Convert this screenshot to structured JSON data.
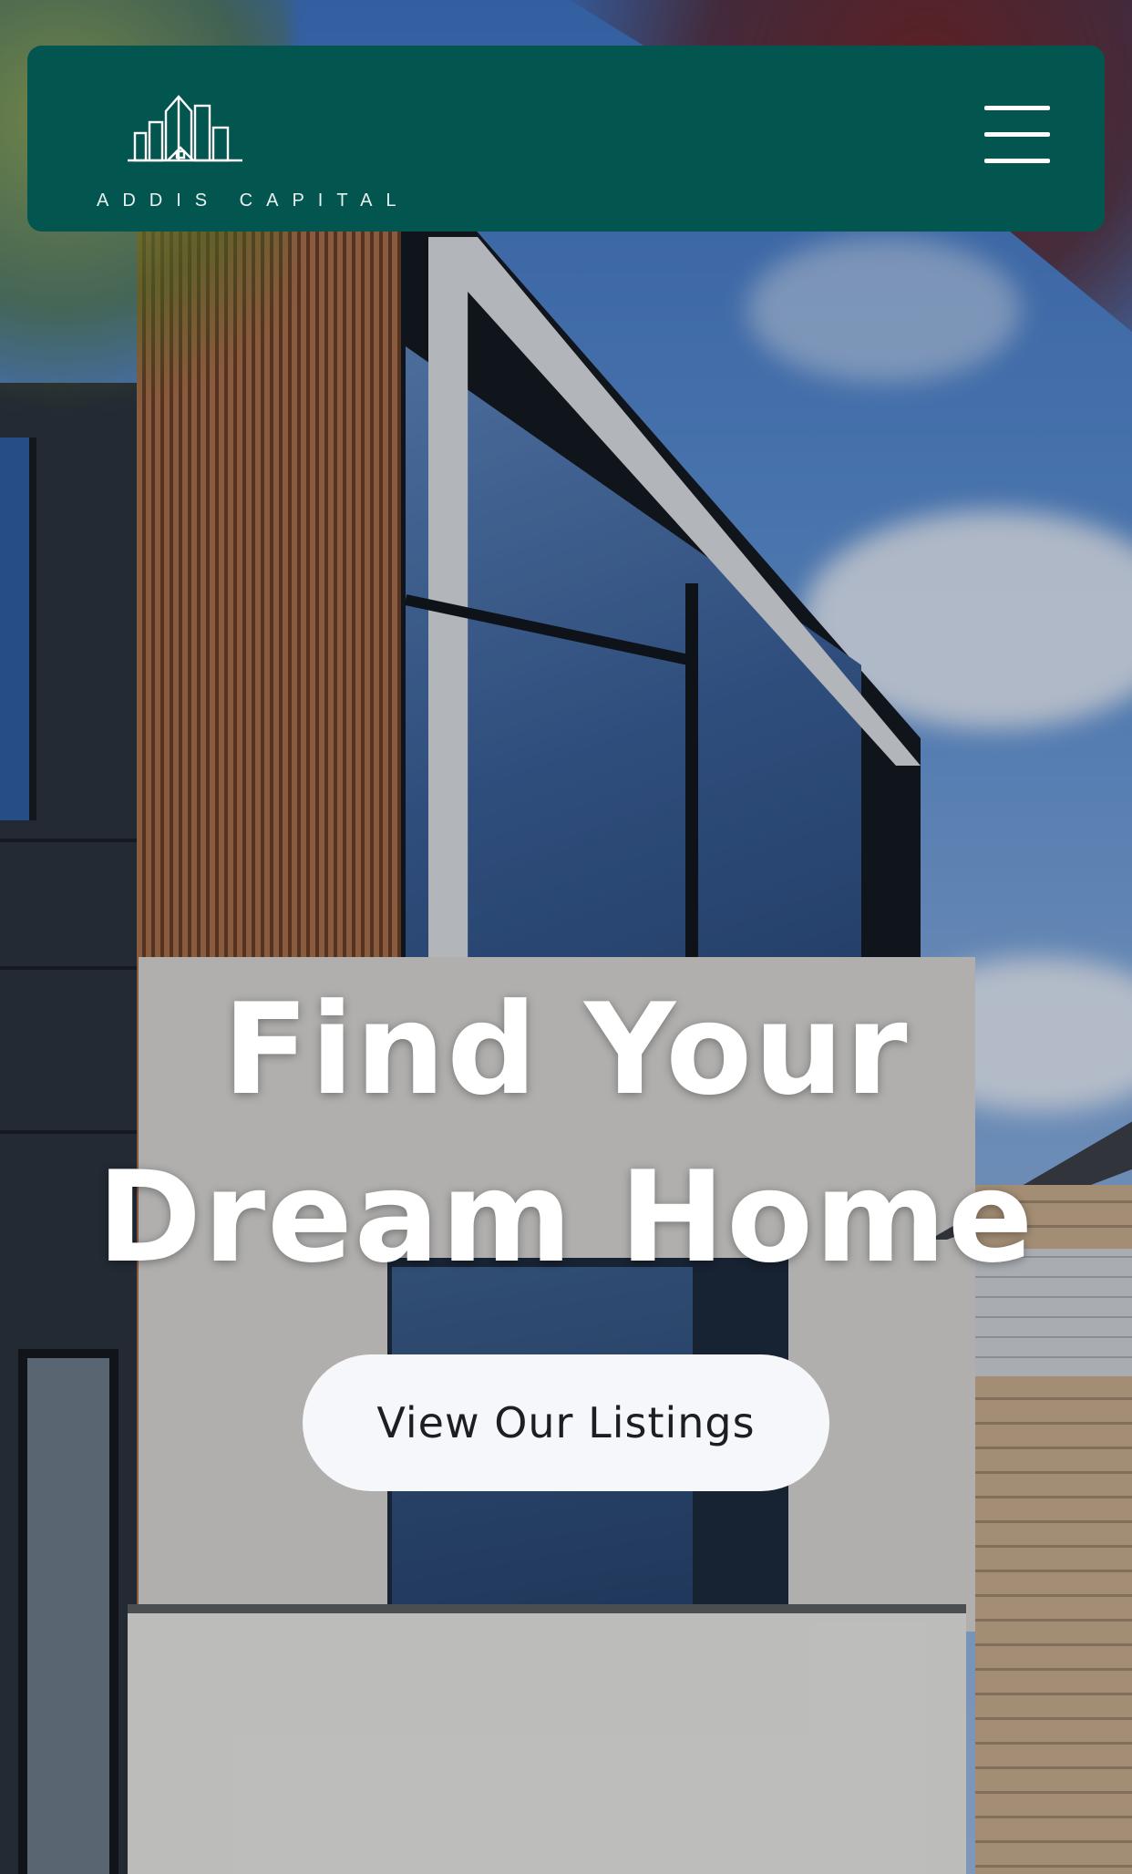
{
  "header": {
    "brand_name": "ADDIS CAPITAL",
    "logo_icon": "city-buildings-logo",
    "menu_icon": "hamburger-menu-icon",
    "background_color": "#03564f"
  },
  "hero": {
    "title_line1": "Find Your",
    "title_line2": "Dream Home",
    "cta_label": "View Our Listings",
    "cta_background": "#f5f7fa",
    "background_image": "modern-house-photo"
  }
}
